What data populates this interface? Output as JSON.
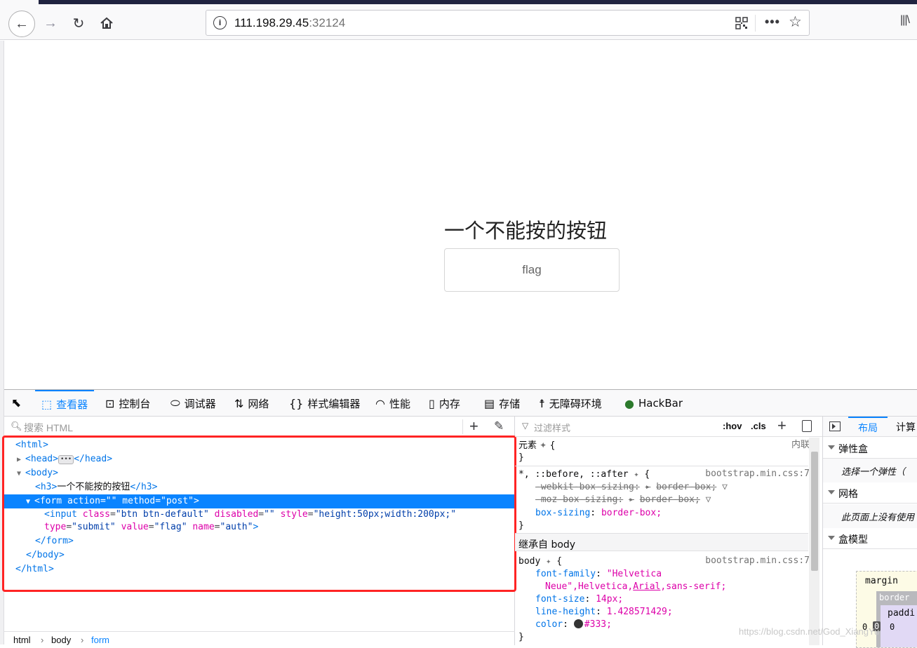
{
  "browser": {
    "url_host": "111.198.29.45",
    "url_port": ":32124"
  },
  "page": {
    "heading": "一个不能按的按钮",
    "button_label": "flag"
  },
  "devtools": {
    "tabs": [
      {
        "label": "查看器",
        "icon": "inspector-icon"
      },
      {
        "label": "控制台",
        "icon": "console-icon"
      },
      {
        "label": "调试器",
        "icon": "debugger-icon"
      },
      {
        "label": "网络",
        "icon": "network-icon"
      },
      {
        "label": "样式编辑器",
        "icon": "style-editor-icon"
      },
      {
        "label": "性能",
        "icon": "performance-icon"
      },
      {
        "label": "内存",
        "icon": "memory-icon"
      },
      {
        "label": "存储",
        "icon": "storage-icon"
      },
      {
        "label": "无障碍环境",
        "icon": "accessibility-icon"
      },
      {
        "label": "HackBar",
        "icon": "hackbar-icon"
      }
    ],
    "markup": {
      "search_placeholder": "搜索 HTML",
      "h3_text": "一个不能按的按钮",
      "breadcrumb": [
        "html",
        "body",
        "form"
      ]
    },
    "rules": {
      "filter_placeholder": "过滤样式",
      "hov": ":hov",
      "cls": ".cls",
      "element_selector": "元素",
      "inline_label": "内联",
      "universal_selector": "*, ::before, ::after",
      "source": "bootstrap.min.css:7",
      "webkit_prop": "-webkit-box-sizing:",
      "webkit_val": "border-box;",
      "moz_prop": "-moz-box-sizing:",
      "moz_val": "border-box;",
      "box_prop": "box-sizing",
      "box_val": "border-box;",
      "inherited_header": "继承自 body",
      "body_selector": "body",
      "font_family_prop": "font-family",
      "font_family_val_1": "\"Helvetica",
      "font_family_val_2": "Neue\",Helvetica,",
      "font_family_val_arial": "Arial",
      "font_family_val_3": ",sans-serif;",
      "font_size_prop": "font-size",
      "font_size_val": "14px;",
      "line_height_prop": "line-height",
      "line_height_val": "1.428571429;",
      "color_prop": "color",
      "color_val": "#333;",
      "color_swatch": "#333333"
    },
    "layout": {
      "tab_layout": "布局",
      "tab_computed": "计算",
      "flexbox_title": "弹性盒",
      "flexbox_body": "选择一个弹性（",
      "grid_title": "网格",
      "grid_body": "此页面上没有使用",
      "boxmodel_title": "盒模型",
      "margin_label": "margin",
      "border_label": "border",
      "padding_label": "paddi",
      "zero": "0"
    }
  },
  "watermark": "https://blog.csdn.net/God_XiangYu"
}
